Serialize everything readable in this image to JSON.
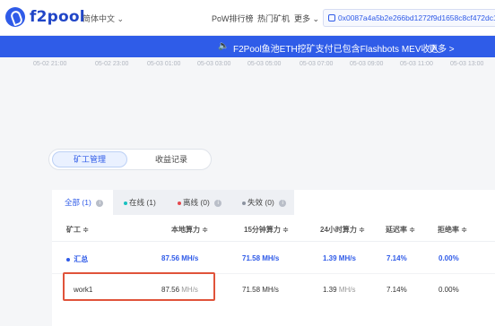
{
  "header": {
    "brand": "f2pool",
    "language": "简体中文",
    "nav": [
      "PoW排行榜",
      "热门矿机",
      "更多"
    ],
    "address": "0x0087a4a5b2e266bd1272f9d1658c8cf472dc15fe",
    "brand_color": "#2f5be8"
  },
  "banner": {
    "text": "F2Pool鱼池ETH挖矿支付已包含Flashbots MEV收入",
    "more": "更多 >"
  },
  "axis": {
    "ticks": [
      "05-02 21:00",
      "05-02 23:00",
      "05-03 01:00",
      "05-03 03:00",
      "05-03 05:00",
      "05-03 07:00",
      "05-03 09:00",
      "05-03 11:00",
      "05-03 13:00"
    ]
  },
  "segment": {
    "active": "矿工管理",
    "other": "收益记录"
  },
  "filters": [
    {
      "label": "全部",
      "count": "(1)",
      "dot": ""
    },
    {
      "label": "在线",
      "count": "(1)",
      "dot": "#18c1c0"
    },
    {
      "label": "离线",
      "count": "(0)",
      "dot": "#e5484d"
    },
    {
      "label": "失效",
      "count": "(0)",
      "dot": "#8c93a0"
    }
  ],
  "table": {
    "headers": [
      "矿工 ≑",
      "本地算力 ≑",
      "15分钟算力 ≑",
      "24小时算力 ≑",
      "延迟率 ≑",
      "拒绝率 ≑"
    ],
    "summary": {
      "name": "汇总",
      "local": "87.56 MH/s",
      "m15": "71.58 MH/s",
      "h24": "1.39 MH/s",
      "delay": "7.14%",
      "reject": "0.00%"
    },
    "worker": {
      "name": "work1",
      "local_val": "87.56",
      "local_unit": "MH/s",
      "m15": "71.58 MH/s",
      "h24_val": "1.39",
      "h24_unit": "MH/s",
      "delay": "7.14%",
      "reject": "0.00%"
    }
  }
}
